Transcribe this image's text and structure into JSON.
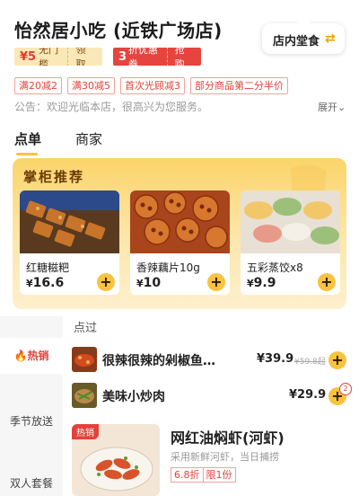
{
  "store": {
    "title": "怡然居小吃 (近铁广场店)"
  },
  "mode": {
    "label": "店内堂食",
    "icon": "swap-arrows-icon"
  },
  "coupons": [
    {
      "amount": "¥5",
      "text": "无门槛",
      "action": "领取"
    },
    {
      "amount": "3",
      "text": "折优惠券",
      "action": "抢购"
    }
  ],
  "promos": [
    "满20减2",
    "满30减5",
    "首次光顾减3",
    "部分商品第二分半价"
  ],
  "notice": {
    "text": "公告：欢迎光临本店，很高兴为您服务。",
    "expand": "展开⌄"
  },
  "tabs": {
    "order": "点单",
    "merchant": "商家"
  },
  "featured": {
    "title": "掌柜推荐",
    "currency": "¥",
    "items": [
      {
        "name": "红糖糍粑",
        "price": "16.6"
      },
      {
        "name": "香辣藕片10g",
        "price": "10"
      },
      {
        "name": "五彩蒸饺x8",
        "price": "9.9"
      }
    ]
  },
  "sidebar": {
    "items": [
      "热销",
      "季节放送",
      "双人套餐"
    ],
    "active_icon": "flame-icon"
  },
  "section": {
    "label": "点过"
  },
  "dishes": [
    {
      "name": "很辣很辣的剁椒鱼…",
      "currency": "¥",
      "price": "39.9",
      "original": "¥59.8起",
      "cart_count": null
    },
    {
      "name": "美味小炒肉",
      "currency": "¥",
      "price": "29.9",
      "original": "",
      "cart_count": "2"
    }
  ],
  "big_item": {
    "tag": "热销",
    "name": "网红油焖虾(河虾)",
    "desc": "采用新鲜河虾，当日捕捞",
    "tags": [
      "6.8折",
      "限1份"
    ]
  },
  "colors": {
    "accent": "#f7c341",
    "red": "#e2423a",
    "brown": "#6a3b06"
  }
}
